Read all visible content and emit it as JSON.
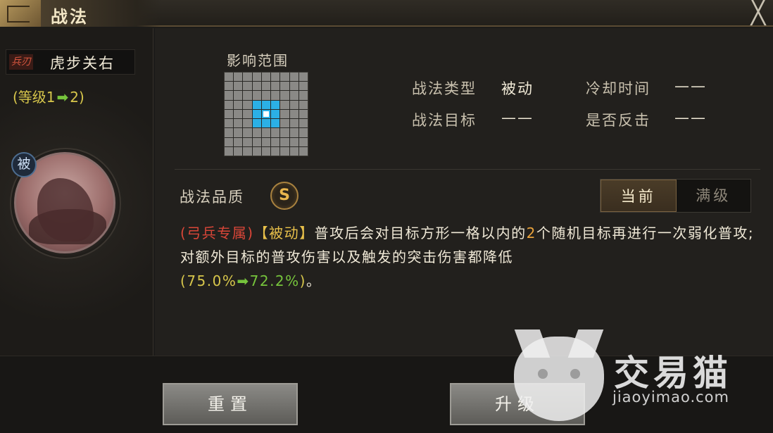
{
  "window": {
    "title": "战法",
    "close_glyph": "╳"
  },
  "troop": {
    "tag": "兵刃",
    "name": "虎步关右",
    "level_prefix": "(等级1",
    "level_arrow": "➡",
    "level_suffix": "2)"
  },
  "skill_icon": {
    "badge": "被"
  },
  "range": {
    "title": "影响范围"
  },
  "info": {
    "type_label": "战法类型",
    "type_value": "被动",
    "cooldown_label": "冷却时间",
    "cooldown_value": "——",
    "target_label": "战法目标",
    "target_value": "——",
    "counter_label": "是否反击",
    "counter_value": "——"
  },
  "quality": {
    "label": "战法品质",
    "grade": "S"
  },
  "toggle": {
    "current": "当前",
    "max": "满级"
  },
  "description": {
    "exclusive": "(弓兵专属)",
    "kind": "【被动】",
    "part1": "普攻后会对目标方形一格以内的",
    "count": "2",
    "part2": "个随机目标再进行一次弱化普攻;对额外目标的普攻伤害以及触发的突击伤害都降低",
    "open": "(",
    "from": "75.0%",
    "arrow": "➡",
    "to": "72.2%",
    "close": ")",
    "end": "。"
  },
  "buttons": {
    "reset": "重置",
    "upgrade": "升级"
  },
  "watermark": {
    "brand": "交易猫",
    "url": "jiaoyimao.com"
  },
  "colors": {
    "accent_cyan": "#2bb0e6",
    "quality_gold": "#e8b54d",
    "exclusive_red": "#d94638",
    "increase_green": "#76c43c"
  }
}
